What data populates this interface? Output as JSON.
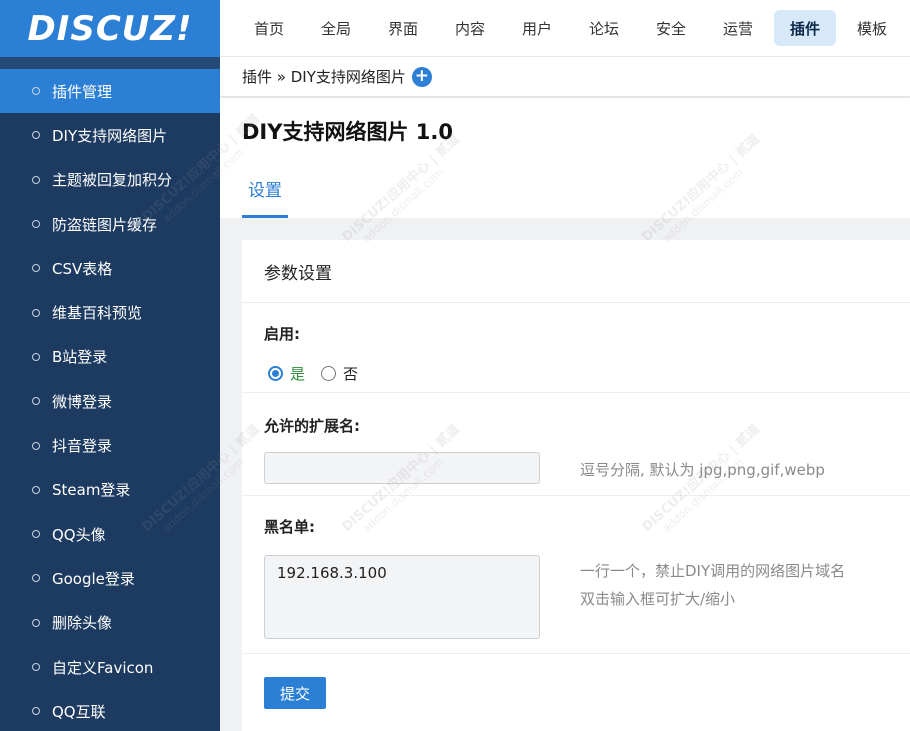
{
  "logo": {
    "text": "DISCUZ!"
  },
  "sidebar": {
    "items": [
      {
        "label": "插件管理",
        "active": true
      },
      {
        "label": "DIY支持网络图片"
      },
      {
        "label": "主题被回复加积分"
      },
      {
        "label": "防盗链图片缓存"
      },
      {
        "label": "CSV表格"
      },
      {
        "label": "维基百科预览"
      },
      {
        "label": "B站登录"
      },
      {
        "label": "微博登录"
      },
      {
        "label": "抖音登录"
      },
      {
        "label": "Steam登录"
      },
      {
        "label": "QQ头像"
      },
      {
        "label": "Google登录"
      },
      {
        "label": "删除头像"
      },
      {
        "label": "自定义Favicon"
      },
      {
        "label": "QQ互联"
      }
    ]
  },
  "topnav": {
    "items": [
      {
        "label": "首页"
      },
      {
        "label": "全局"
      },
      {
        "label": "界面"
      },
      {
        "label": "内容"
      },
      {
        "label": "用户"
      },
      {
        "label": "论坛"
      },
      {
        "label": "安全"
      },
      {
        "label": "运营"
      },
      {
        "label": "插件",
        "active": true
      },
      {
        "label": "模板"
      }
    ]
  },
  "breadcrumb": {
    "text": "插件 » DIY支持网络图片",
    "add_symbol": "+"
  },
  "page": {
    "title": "DIY支持网络图片 1.0",
    "tab_label": "设置"
  },
  "card": {
    "header": "参数设置",
    "enable": {
      "label": "启用:",
      "yes": "是",
      "no": "否"
    },
    "ext": {
      "label": "允许的扩展名:",
      "value": "",
      "hint": "逗号分隔, 默认为 jpg,png,gif,webp"
    },
    "blacklist": {
      "label": "黑名单:",
      "value": "192.168.3.100",
      "hint1": "一行一个，禁止DIY调用的网络图片域名",
      "hint2": "双击输入框可扩大/缩小"
    },
    "submit_label": "提交"
  },
  "watermark": {
    "line1": "DISCUZ!应用中心 | 贰道",
    "line2": "addon.dismall.com"
  },
  "colors": {
    "accent": "#2b7fd4",
    "sidebar": "#1d3a60",
    "nav_active_bg": "#d7e8f8"
  }
}
